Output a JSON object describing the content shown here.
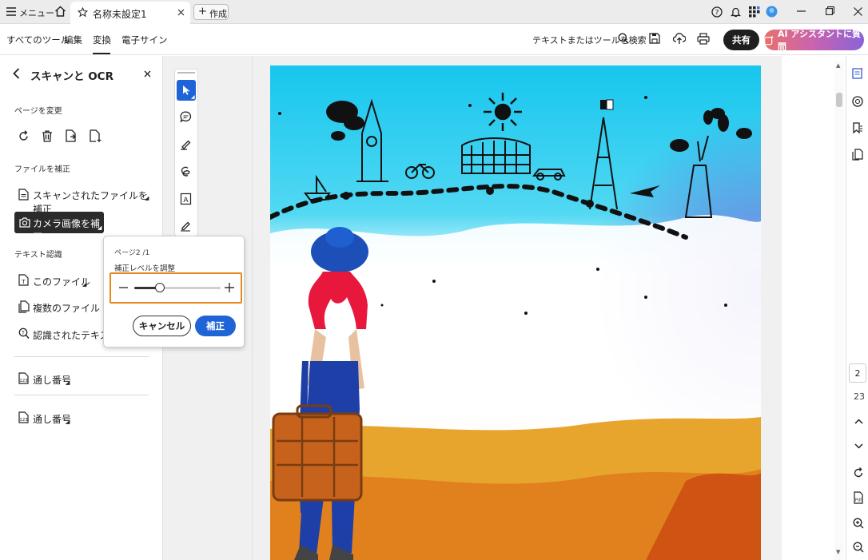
{
  "titlebar": {
    "menu_label": "メニュー",
    "tab_title": "名称未設定1",
    "new_label": "作成"
  },
  "menubar": {
    "items": [
      "すべてのツール",
      "編集",
      "変換",
      "電子サイン"
    ],
    "search_placeholder": "テキストまたはツールを検索",
    "share_label": "共有",
    "ai_label": "AI アシスタントに質問"
  },
  "leftpanel": {
    "title": "スキャンと OCR",
    "sections": {
      "change_page": "ページを変更",
      "fix_file": "ファイルを補正",
      "text_recognition": "テキスト認識"
    },
    "fix_items": [
      "スキャンされたファイルを補正",
      "カメラ画像を補正"
    ],
    "text_items": [
      "このファイル",
      "複数のファイル",
      "認識されたテキスト"
    ],
    "extra_items": [
      "通し番号",
      "通し番号"
    ]
  },
  "popup": {
    "page_info": "ページ2 /1",
    "adjust_label": "補正レベルを調整",
    "cancel_label": "キャンセル",
    "ok_label": "補正",
    "slider_level": 0.3
  },
  "pagenav": {
    "current": "2",
    "total": "23"
  },
  "colors": {
    "accent_blue": "#1f64d6",
    "highlight_orange": "#e4891f",
    "share_dark": "#1f1f1f"
  }
}
